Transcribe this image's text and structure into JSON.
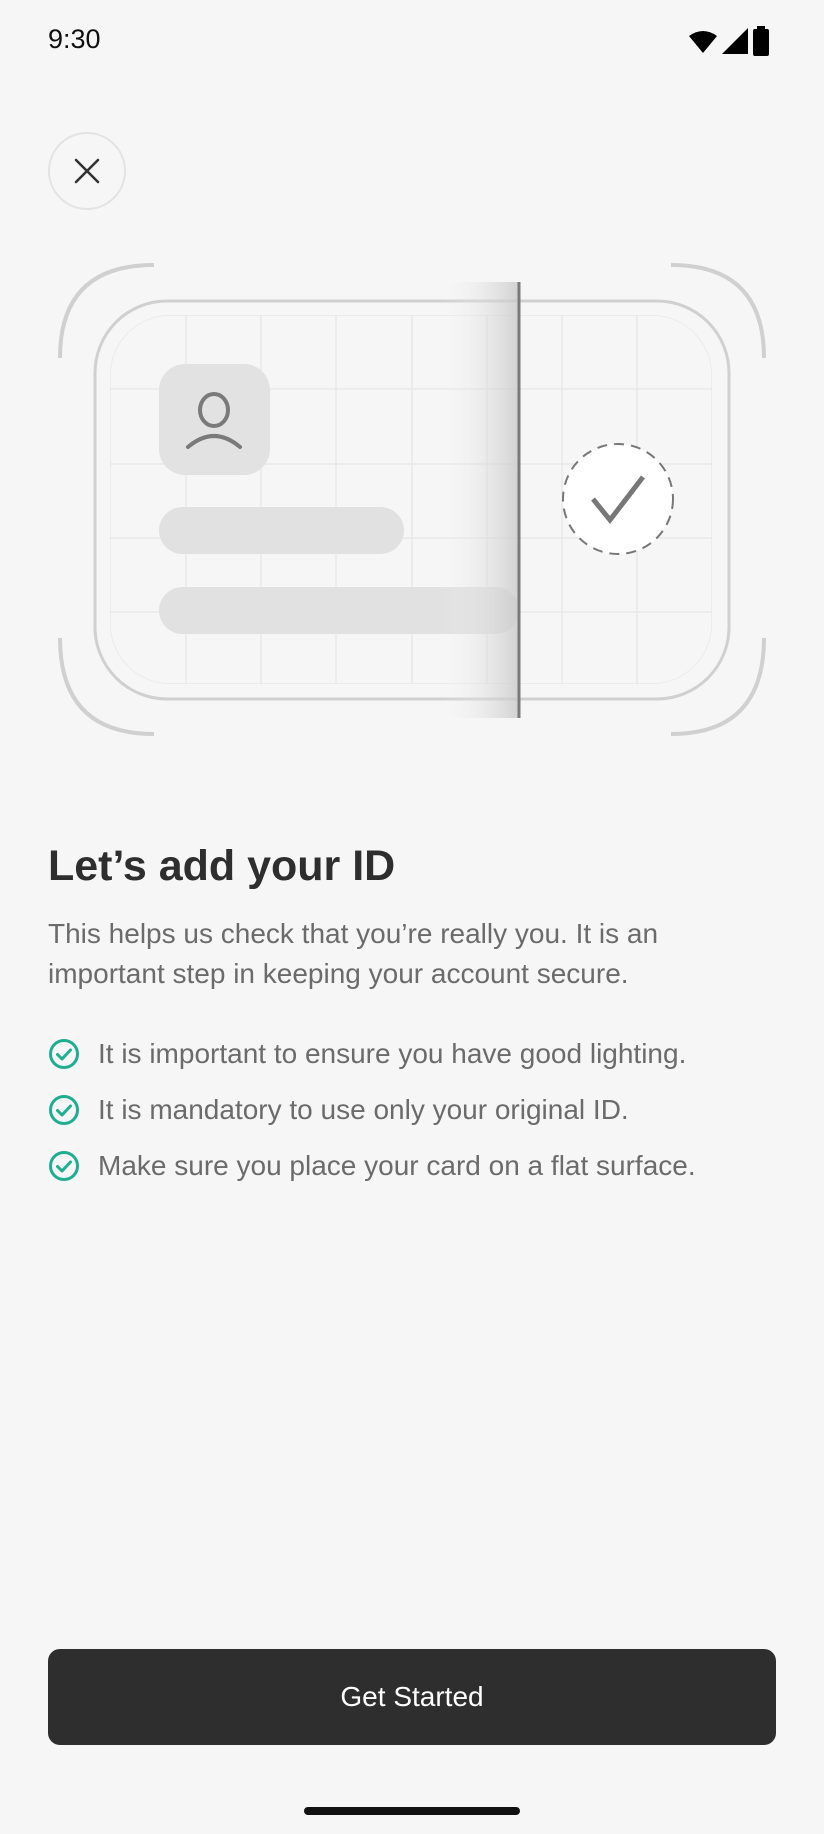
{
  "status_bar": {
    "time": "9:30",
    "icons": [
      "wifi-icon",
      "signal-icon",
      "battery-icon"
    ]
  },
  "close_button": {
    "icon": "close-icon"
  },
  "content": {
    "title": "Let’s add your ID",
    "description": "This helps us check that you’re really you. It is an important step in keeping your account secure.",
    "tips": [
      "It is important to ensure you have good lighting.",
      "It is mandatory to use only your original ID.",
      "Make sure you place your card on a flat surface."
    ],
    "tip_icon": "check-circle-icon"
  },
  "footer": {
    "cta_label": "Get Started"
  },
  "colors": {
    "accent": "#1fae8f",
    "button": "#2e2e2e",
    "background": "#f6f6f6"
  }
}
